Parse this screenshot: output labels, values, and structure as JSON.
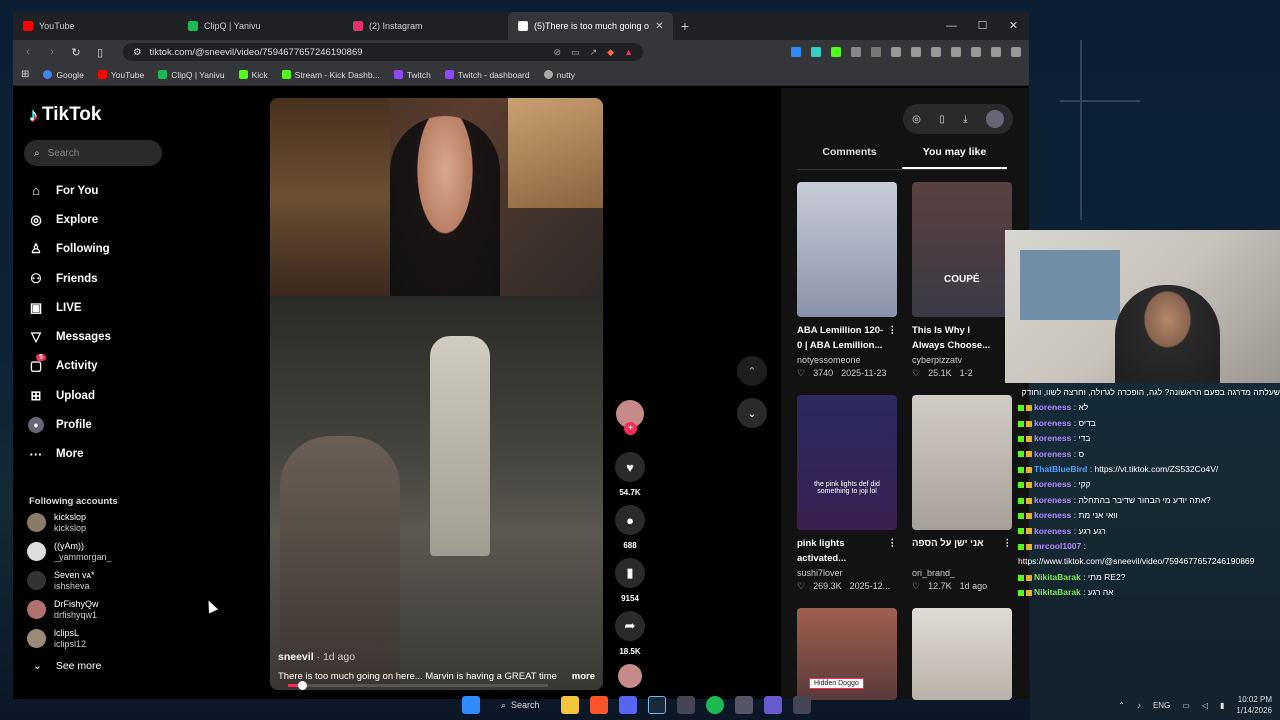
{
  "tabs": [
    {
      "label": "YouTube",
      "color": "#ff0000"
    },
    {
      "label": "ClipQ | Yanivu",
      "color": "#1db954"
    },
    {
      "label": "(2) Instagram",
      "color": "#e1306c"
    },
    {
      "label": "(5)There is too much going o",
      "color": "#ffffff"
    }
  ],
  "url": "tiktok.com/@sneevil/video/7594677657246190869",
  "bookmarks": [
    {
      "label": "Google",
      "color": "#4285f4"
    },
    {
      "label": "YouTube",
      "color": "#ff0000"
    },
    {
      "label": "ClipQ | Yanivu",
      "color": "#1db954"
    },
    {
      "label": "Kick",
      "color": "#53fc18"
    },
    {
      "label": "Stream - Kick Dashb...",
      "color": "#53fc18"
    },
    {
      "label": "Twitch",
      "color": "#9146ff"
    },
    {
      "label": "Twitch - dashboard",
      "color": "#9146ff"
    },
    {
      "label": "nutty",
      "color": "#aaaaaa"
    }
  ],
  "logo": "TikTok",
  "search_placeholder": "Search",
  "menu": [
    {
      "label": "For You",
      "icon": "home-icon"
    },
    {
      "label": "Explore",
      "icon": "compass-icon"
    },
    {
      "label": "Following",
      "icon": "following-icon"
    },
    {
      "label": "Friends",
      "icon": "friends-icon"
    },
    {
      "label": "LIVE",
      "icon": "live-icon"
    },
    {
      "label": "Messages",
      "icon": "messages-icon"
    },
    {
      "label": "Activity",
      "icon": "activity-icon",
      "badge": "5"
    },
    {
      "label": "Upload",
      "icon": "upload-icon"
    },
    {
      "label": "Profile",
      "icon": "profile-icon"
    },
    {
      "label": "More",
      "icon": "more-icon"
    }
  ],
  "following_title": "Following accounts",
  "following": [
    {
      "name": "kickslop",
      "handle": "kickslop"
    },
    {
      "name": "((yAm))",
      "handle": "_yammorgan_"
    },
    {
      "name": "Seven ᴠᴀ*",
      "handle": "ishsheva"
    },
    {
      "name": "DrFishyQw",
      "handle": "drfishyqw1"
    },
    {
      "name": "lclipsL",
      "handle": "iclipsl12"
    }
  ],
  "see_more": "See more",
  "video": {
    "author": "sneevil",
    "ago": "· 1d ago",
    "description": "There is too much going on here... Marvin is having a GREAT time",
    "more": "more",
    "progress": 0.04
  },
  "actions": {
    "likes": "54.7K",
    "comments": "688",
    "saves": "9154",
    "shares": "18.5K"
  },
  "right_tabs": [
    "Comments",
    "You may like"
  ],
  "cards": [
    {
      "title": "ABA Lemillion 120-0 | ABA Lemillion...",
      "author": "notyessomeone",
      "likes": "3740",
      "date": "2025-11-23",
      "color": "#9aa6b8"
    },
    {
      "title": "This Is Why I Always Choose...",
      "author": "cyberpizzatv",
      "likes": "25.1K",
      "date": "1-2",
      "color": "#5a4a4a",
      "thumb_text": "COUPÉ"
    },
    {
      "title": "pink lights activated...",
      "author": "sushi7lover",
      "likes": "269.3K",
      "date": "2025-12...",
      "color": "#2a2a5a",
      "thumb_text": "the pink lights def did something to joji lol"
    },
    {
      "title": "אני ישן על הספה",
      "author": "ori_brand_",
      "likes": "12.7K",
      "date": "1d ago",
      "color": "#b8b0a8"
    },
    {
      "title": "",
      "author": "",
      "likes": "",
      "date": "",
      "color": "#8a5a4a",
      "thumb_text": "Hidden Doggo"
    },
    {
      "title": "",
      "author": "",
      "likes": "",
      "date": "",
      "color": "#cfcac0"
    }
  ],
  "chat": [
    {
      "user": "",
      "text": "שעלתה מדרגה בפעם הראשונה? לגה, הופכרה לגרולה, וחרצה לשוו, וחודק",
      "color": "#ffffff"
    },
    {
      "user": "koreness",
      "text": ": לא",
      "color": "#b388ff"
    },
    {
      "user": "koreness",
      "text": ": בדיס",
      "color": "#b388ff"
    },
    {
      "user": "koreness",
      "text": ": בדי",
      "color": "#b388ff"
    },
    {
      "user": "koreness",
      "text": ": ס",
      "color": "#b388ff"
    },
    {
      "user": "ThatBlueBird",
      "text": ": https://vt.tiktok.com/ZS532Co4V/",
      "color": "#4aa3ff"
    },
    {
      "user": "koreness",
      "text": ": קקי",
      "color": "#b388ff"
    },
    {
      "user": "koreness",
      "text": ": אתה יודע מי הבחור שדיבר בהתחלה?",
      "color": "#b388ff"
    },
    {
      "user": "koreness",
      "text": ": וואי אני מת",
      "color": "#b388ff"
    },
    {
      "user": "koreness",
      "text": ": רגע רגע",
      "color": "#b388ff"
    },
    {
      "user": "mrcool1007",
      "text": ":",
      "color": "#b388ff"
    },
    {
      "user": "",
      "text": "https://www.tiktok.com/@sneevil/video/7594677657246190869",
      "color": "#ffffff"
    },
    {
      "user": "NikitaBarak",
      "text": ": מתי RE2?",
      "color": "#7fe35a"
    },
    {
      "user": "NikitaBarak",
      "text": ": אה רגע",
      "color": "#7fe35a"
    }
  ],
  "taskbar": {
    "search": "Search",
    "lang": "ENG",
    "time": "10:02 PM",
    "date": "1/14/2026"
  }
}
